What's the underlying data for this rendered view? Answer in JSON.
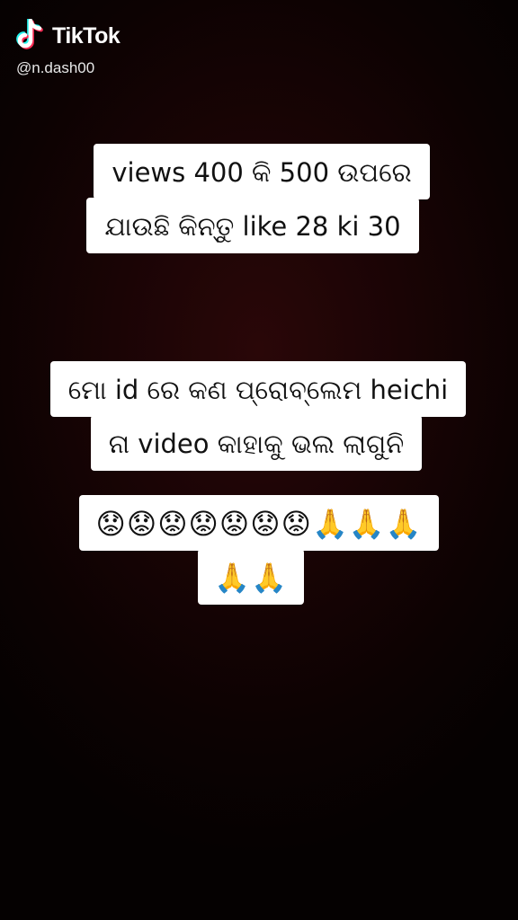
{
  "brand": {
    "logo_icon": "tiktok-note-icon",
    "name": "TikTok",
    "colors": {
      "cyan": "#25f4ee",
      "red": "#fe2c55",
      "white": "#ffffff"
    }
  },
  "handle": "@n.dash00",
  "captions": [
    {
      "lines": [
        "views 400 କି 500 ଉପରେ",
        "ଯାଉଛି  କିନ୍ତୁ like 28 ki 30"
      ]
    },
    {
      "lines": [
        "ମୋ id ରେ କଣ ପ୍ରୋବ୍ଲେମ heichi",
        "ନା video କାହାକୁ ଭଲ ଲାଗୁନି"
      ]
    },
    {
      "lines": [
        "😟😟😟😟😟😟😟🙏🙏🙏",
        "🙏🙏"
      ]
    }
  ]
}
